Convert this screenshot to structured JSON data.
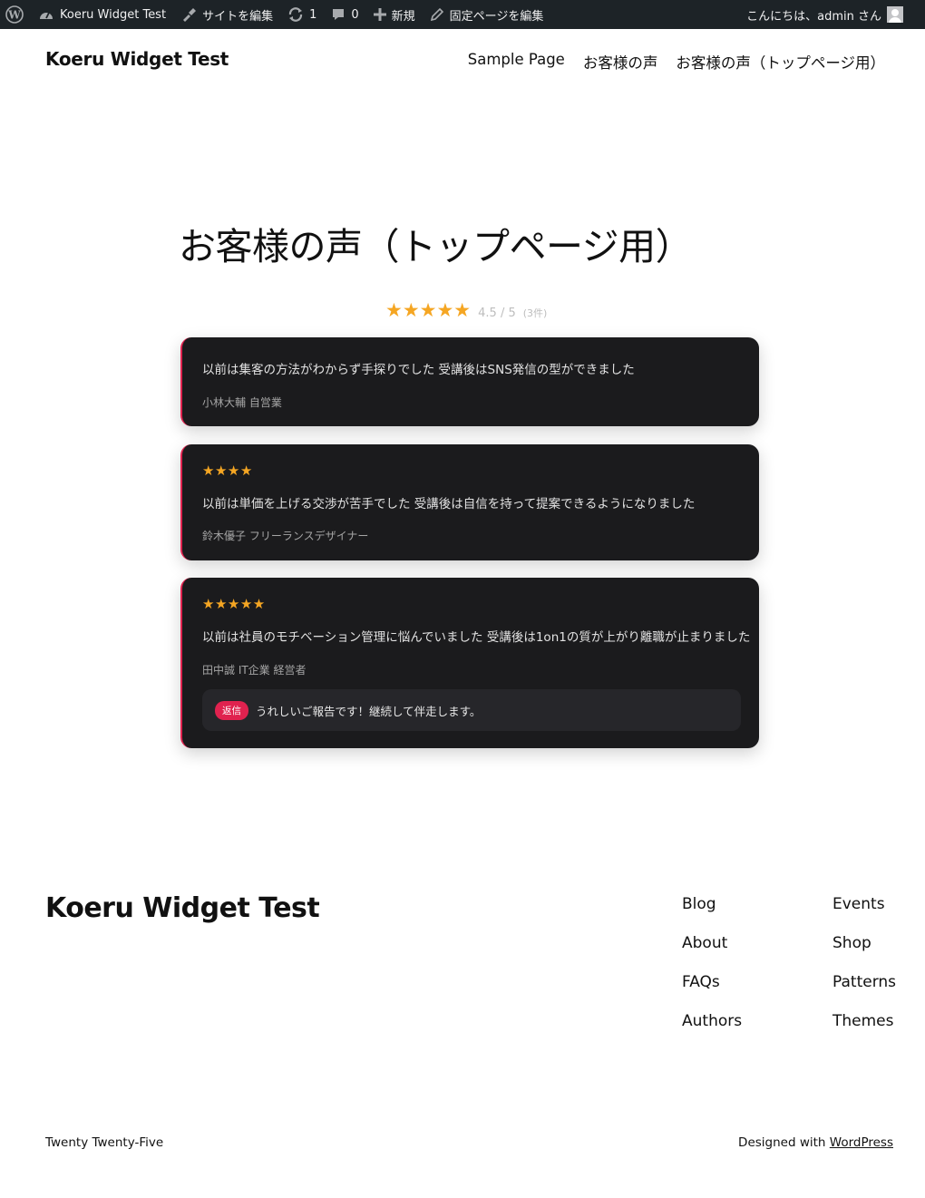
{
  "adminbar": {
    "wp_logo_icon": "wordpress-logo-icon",
    "site_name": "Koeru Widget Test",
    "customize": "サイトを編集",
    "updates_count": "1",
    "comments_count": "0",
    "new_label": "新規",
    "edit_page": "固定ページを編集",
    "greeting": "こんにちは、admin さん"
  },
  "header": {
    "site_title": "Koeru Widget Test",
    "nav": [
      "Sample Page",
      "お客様の声",
      "お客様の声（トップページ用）"
    ]
  },
  "main": {
    "title": "お客様の声（トップページ用）",
    "summary": {
      "stars": "★★★★★",
      "score": "4.5 / 5",
      "count": "(3件)"
    },
    "reviews": [
      {
        "stars": "",
        "text": "以前は集客の方法がわからず手探りでした 受講後はSNS発信の型ができました",
        "author": "小林大輔 自営業"
      },
      {
        "stars": "★★★★",
        "text": "以前は単価を上げる交渉が苦手でした 受講後は自信を持って提案できるようになりました",
        "author": "鈴木優子 フリーランスデザイナー"
      },
      {
        "stars": "★★★★★",
        "text": "以前は社員のモチベーション管理に悩んでいました 受講後は1on1の質が上がり離職が止まりました",
        "author": "田中誠 IT企業 経営者",
        "reply_badge": "返信",
        "reply_text": "うれしいご報告です！継続して伴走します。"
      }
    ]
  },
  "footer": {
    "title": "Koeru Widget Test",
    "col1": [
      "Blog",
      "About",
      "FAQs",
      "Authors"
    ],
    "col2": [
      "Events",
      "Shop",
      "Patterns",
      "Themes"
    ],
    "theme_credit": "Twenty Twenty-Five",
    "designed_with": "Designed with",
    "wordpress": "WordPress"
  },
  "colors": {
    "adminbar_bg": "#1d2327",
    "star": "#f5a623",
    "card_bg": "#1b1b1d",
    "accent": "#e0224f"
  }
}
